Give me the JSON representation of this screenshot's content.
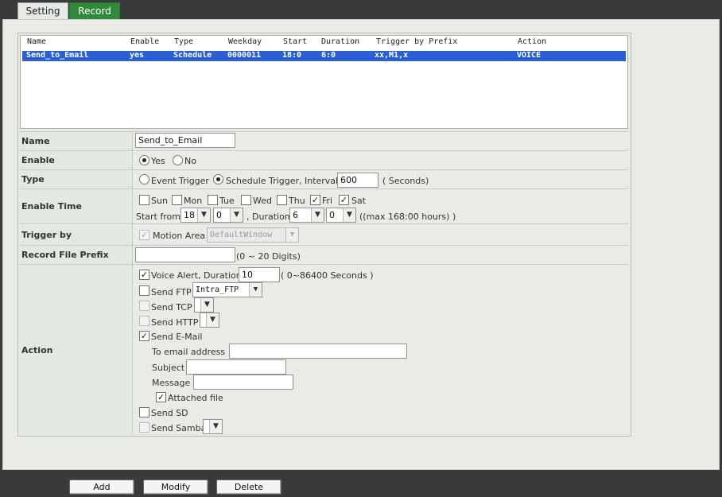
{
  "tabs": [
    {
      "label": "Setting",
      "active": false
    },
    {
      "label": "Record",
      "active": true
    }
  ],
  "rule_list": {
    "headers": [
      "Name",
      "Enable",
      "Type",
      "Weekday",
      "Start",
      "Duration",
      "Trigger by Prefix",
      "Action"
    ],
    "rows": [
      {
        "name": "Send_to_Email",
        "enable": "yes",
        "type": "Schedule",
        "weekday": "0000011",
        "start": "18:0",
        "duration": "6:0",
        "trigger": "xx,M1,x",
        "action": "VOICE",
        "selected": true
      }
    ]
  },
  "form": {
    "name": {
      "label": "Name",
      "value": "Send_to_Email"
    },
    "enable": {
      "label": "Enable",
      "yes": "Yes",
      "no": "No",
      "selected": "Yes"
    },
    "type": {
      "label": "Type",
      "event": "Event Trigger",
      "schedule": "Schedule Trigger, Interval",
      "interval": "600",
      "unit": "( Seconds)",
      "selected": "schedule"
    },
    "enable_time": {
      "label": "Enable Time",
      "days": [
        {
          "label": "Sun",
          "checked": false
        },
        {
          "label": "Mon",
          "checked": false
        },
        {
          "label": "Tue",
          "checked": false
        },
        {
          "label": "Wed",
          "checked": false
        },
        {
          "label": "Thu",
          "checked": false
        },
        {
          "label": "Fri",
          "checked": true
        },
        {
          "label": "Sat",
          "checked": true
        }
      ],
      "start_label": "Start from",
      "start_hour": "18",
      "start_min": "0",
      "duration_label": ", Duration",
      "dur_hour": "6",
      "dur_min": "0",
      "max_note": "((max 168:00 hours) )"
    },
    "trigger_by": {
      "label": "Trigger by",
      "motion_area": "Motion Area",
      "window": "DefaultWindow"
    },
    "prefix": {
      "label": "Record File Prefix",
      "value": "",
      "note": "(0 ~ 20 Digits)"
    },
    "action": {
      "label": "Action",
      "voice_alert": "Voice Alert, Duration",
      "voice_duration": "10",
      "voice_note": "( 0~86400 Seconds )",
      "send_ftp": "Send FTP",
      "ftp_value": "Intra_FTP",
      "send_tcp": "Send TCP",
      "send_http": "Send HTTP",
      "send_email": "Send E-Mail",
      "to_email": "To email address",
      "subject": "Subject",
      "message": "Message",
      "attached_file": "Attached file",
      "send_sd": "Send SD",
      "send_samba": "Send Samba"
    }
  },
  "buttons": {
    "add": "Add",
    "modify": "Modify",
    "delete": "Delete"
  }
}
